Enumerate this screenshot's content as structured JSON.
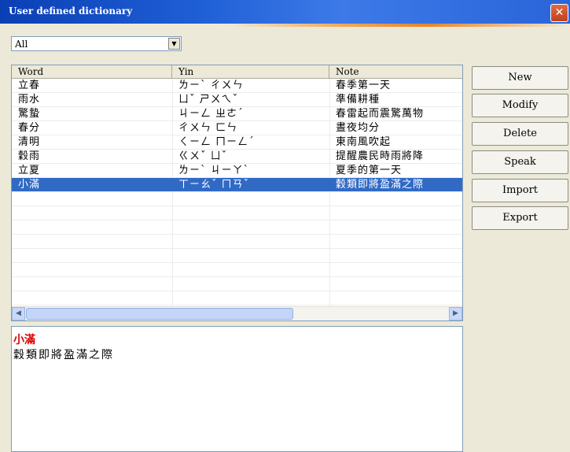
{
  "window": {
    "title": "User defined dictionary",
    "close_glyph": "✕"
  },
  "filter": {
    "value": "All",
    "arrow": "▼"
  },
  "table": {
    "headers": [
      "Word",
      "Yin",
      "Note"
    ],
    "rows": [
      {
        "word": "立春",
        "yin": "ㄌㄧˋ ㄔㄨㄣ",
        "note": "春季第一天"
      },
      {
        "word": "雨水",
        "yin": "ㄩˇ ㄕㄨㄟˇ",
        "note": "準備耕種"
      },
      {
        "word": "驚蟄",
        "yin": "ㄐㄧㄥ ㄓㄜˊ",
        "note": "春雷起而震驚萬物"
      },
      {
        "word": "春分",
        "yin": "ㄔㄨㄣ ㄈㄣ",
        "note": "晝夜均分"
      },
      {
        "word": "清明",
        "yin": "ㄑㄧㄥ ㄇㄧㄥˊ",
        "note": "東南風吹起"
      },
      {
        "word": "穀雨",
        "yin": "ㄍㄨˇ ㄩˇ",
        "note": "提醒農民時雨將降"
      },
      {
        "word": "立夏",
        "yin": "ㄌㄧˋ ㄐㄧㄚˋ",
        "note": "夏季的第一天"
      },
      {
        "word": "小滿",
        "yin": "ㄒㄧㄠˇ ㄇㄢˇ",
        "note": "穀類即將盈滿之際"
      }
    ],
    "selected_index": 7
  },
  "buttons": {
    "new": "New",
    "modify": "Modify",
    "delete": "Delete",
    "speak": "Speak",
    "import": "Import",
    "export": "Export"
  },
  "detail": {
    "word": "小滿",
    "note": "穀類即將盈滿之際"
  },
  "colors": {
    "selection": "#316ac5",
    "detail_word": "#e00000",
    "titlebar": "#1f5fd6"
  },
  "icons": {
    "close": "close-icon",
    "dropdown": "chevron-down-icon",
    "scroll_left": "arrow-left-icon",
    "scroll_right": "arrow-right-icon"
  }
}
